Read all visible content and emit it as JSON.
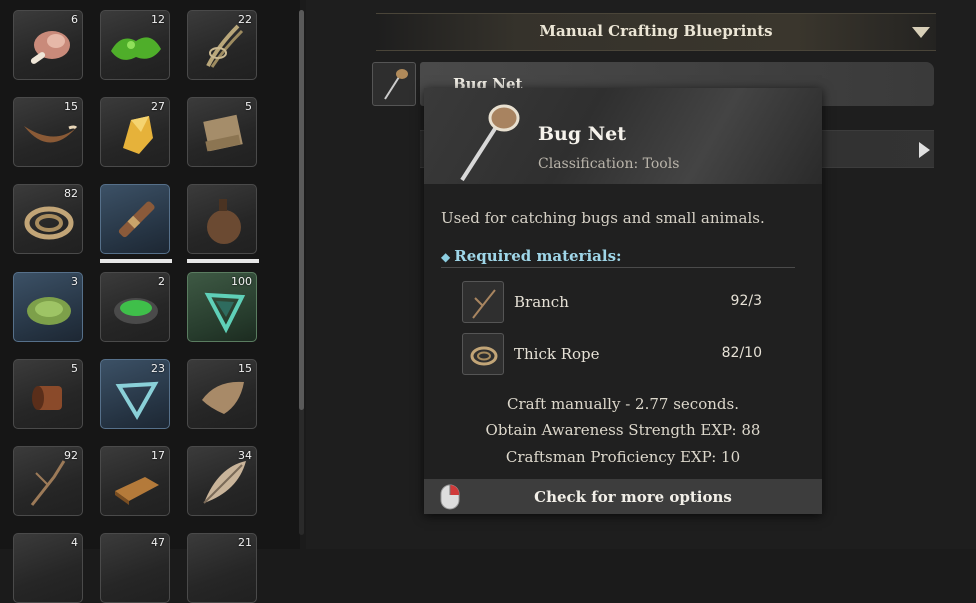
{
  "inventory": {
    "items": [
      {
        "name": "meat",
        "count": "6"
      },
      {
        "name": "slime",
        "count": "12"
      },
      {
        "name": "fiber-bundle",
        "count": "22"
      },
      {
        "name": "horn",
        "count": "15"
      },
      {
        "name": "amber",
        "count": "27"
      },
      {
        "name": "leather-scroll",
        "count": "5"
      },
      {
        "name": "thick-rope",
        "count": "82"
      },
      {
        "name": "spyglass",
        "count": ""
      },
      {
        "name": "waterskin",
        "count": ""
      },
      {
        "name": "green-leaf-bowl",
        "count": "3"
      },
      {
        "name": "potion-bowl",
        "count": "2"
      },
      {
        "name": "crystal-frame",
        "count": "100"
      },
      {
        "name": "thread-spool",
        "count": "5"
      },
      {
        "name": "crystal-frame-small",
        "count": "23"
      },
      {
        "name": "hide-piece",
        "count": "15"
      },
      {
        "name": "branch",
        "count": "92"
      },
      {
        "name": "wood-ingot",
        "count": "17"
      },
      {
        "name": "feather",
        "count": "34"
      },
      {
        "name": "item-row7-a",
        "count": "4"
      },
      {
        "name": "item-row7-b",
        "count": "47"
      },
      {
        "name": "item-row7-c",
        "count": "21"
      }
    ]
  },
  "blueprints": {
    "header": "Manual Crafting Blueprints",
    "selected_label": "Bug Net"
  },
  "tooltip": {
    "name": "Bug Net",
    "classification": "Classification: Tools",
    "description": "Used for catching bugs and small animals.",
    "required_label": "Required materials:",
    "materials": [
      {
        "name": "Branch",
        "qty": "92/3"
      },
      {
        "name": "Thick Rope",
        "qty": "82/10"
      }
    ],
    "craft_time": "Craft manually - 2.77 seconds.",
    "awareness_exp": "Obtain Awareness Strength EXP: 88",
    "proficiency_exp": "Craftsman Proficiency EXP: 10",
    "more_options": "Check for more options"
  },
  "colors": {
    "accent_required": "#9fd6e8",
    "slot_blue": "#3c5166",
    "slot_green": "#3e5944"
  }
}
